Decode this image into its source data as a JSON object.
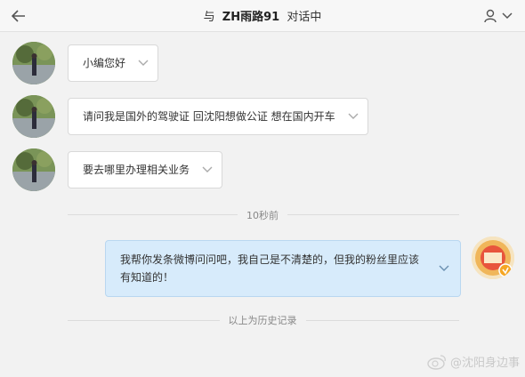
{
  "header": {
    "title_prefix": "与",
    "contact_name": "ZH雨路91",
    "title_suffix": "对话中"
  },
  "messages_in": [
    {
      "text": "小编您好"
    },
    {
      "text": "请问我是国外的驾驶证 回沈阳想做公证 想在国内开车"
    },
    {
      "text": "要去哪里办理相关业务"
    }
  ],
  "time_label": "10秒前",
  "message_out": {
    "text": "我帮你发条微博问问吧，我自己是不清楚的，但我的粉丝里应该有知道的！"
  },
  "history_label": "以上为历史记录",
  "watermark": "@沈阳身边事",
  "colors": {
    "outgoing_bubble": "#d7ebfb",
    "incoming_bubble": "#ffffff",
    "background": "#f2f2f2"
  }
}
